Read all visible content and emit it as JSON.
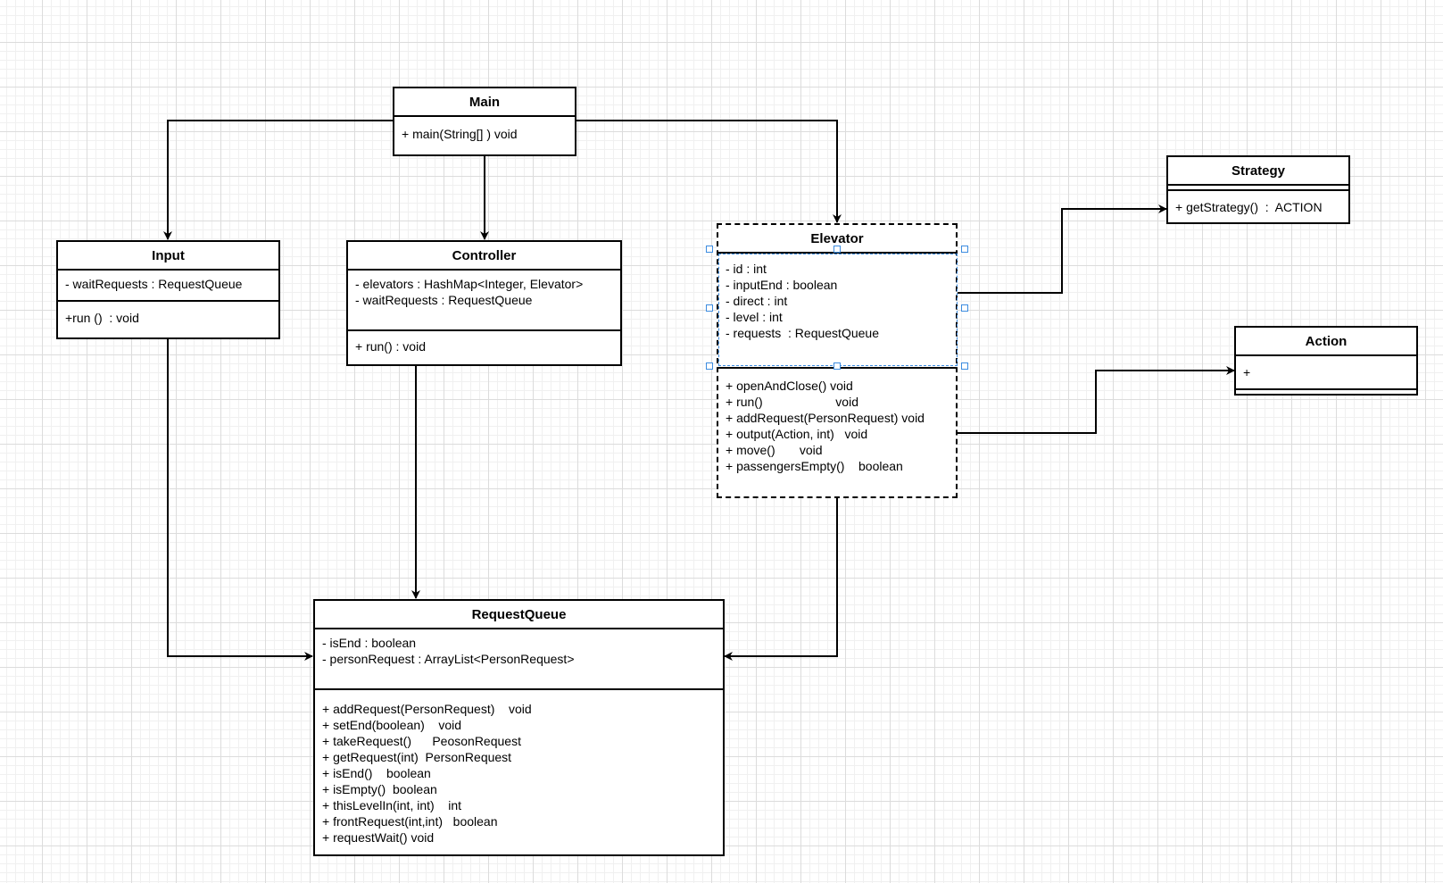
{
  "classes": {
    "main": {
      "name": "Main",
      "attributes": [],
      "methods": [
        "+ main(String[] ) void"
      ]
    },
    "input": {
      "name": "Input",
      "attributes": [
        "- waitRequests : RequestQueue"
      ],
      "methods": [
        "+run ()  : void"
      ]
    },
    "controller": {
      "name": "Controller",
      "attributes": [
        "- elevators : HashMap<Integer, Elevator>",
        "- waitRequests : RequestQueue"
      ],
      "methods": [
        "+ run() : void"
      ]
    },
    "elevator": {
      "name": "Elevator",
      "attributes": [
        "- id : int",
        "- inputEnd : boolean",
        "- direct : int",
        "- level : int",
        "- requests  : RequestQueue"
      ],
      "methods": [
        "+ openAndClose() void",
        "+ run()                     void",
        "+ addRequest(PersonRequest) void",
        "+ output(Action, int)   void",
        "+ move()       void",
        "+ passengersEmpty()    boolean"
      ]
    },
    "strategy": {
      "name": "Strategy",
      "attributes": [],
      "methods": [
        "+ getStrategy()  :  ACTION"
      ]
    },
    "action": {
      "name": "Action",
      "attributes": [],
      "methods": [
        "+"
      ]
    },
    "requestqueue": {
      "name": "RequestQueue",
      "attributes": [
        "- isEnd : boolean",
        "- personRequest : ArrayList<PersonRequest>"
      ],
      "methods": [
        "+ addRequest(PersonRequest)    void",
        "+ setEnd(boolean)    void",
        "+ takeRequest()      PeosonRequest",
        "+ getRequest(int)  PersonRequest",
        "+ isEnd()    boolean",
        "+ isEmpty()  boolean",
        "+ thisLevelIn(int, int)    int",
        "+ frontRequest(int,int)   boolean",
        "+ requestWait() void"
      ]
    }
  },
  "edges": [
    {
      "from": "Main",
      "to": "Input"
    },
    {
      "from": "Main",
      "to": "Controller"
    },
    {
      "from": "Main",
      "to": "Elevator"
    },
    {
      "from": "Elevator",
      "to": "Strategy"
    },
    {
      "from": "Elevator",
      "to": "Action"
    },
    {
      "from": "Input",
      "to": "RequestQueue"
    },
    {
      "from": "Controller",
      "to": "RequestQueue"
    },
    {
      "from": "Elevator",
      "to": "RequestQueue"
    }
  ],
  "colors": {
    "line": "#000000",
    "selection": "#3c8ce0",
    "grid": "#dcdcdc"
  }
}
